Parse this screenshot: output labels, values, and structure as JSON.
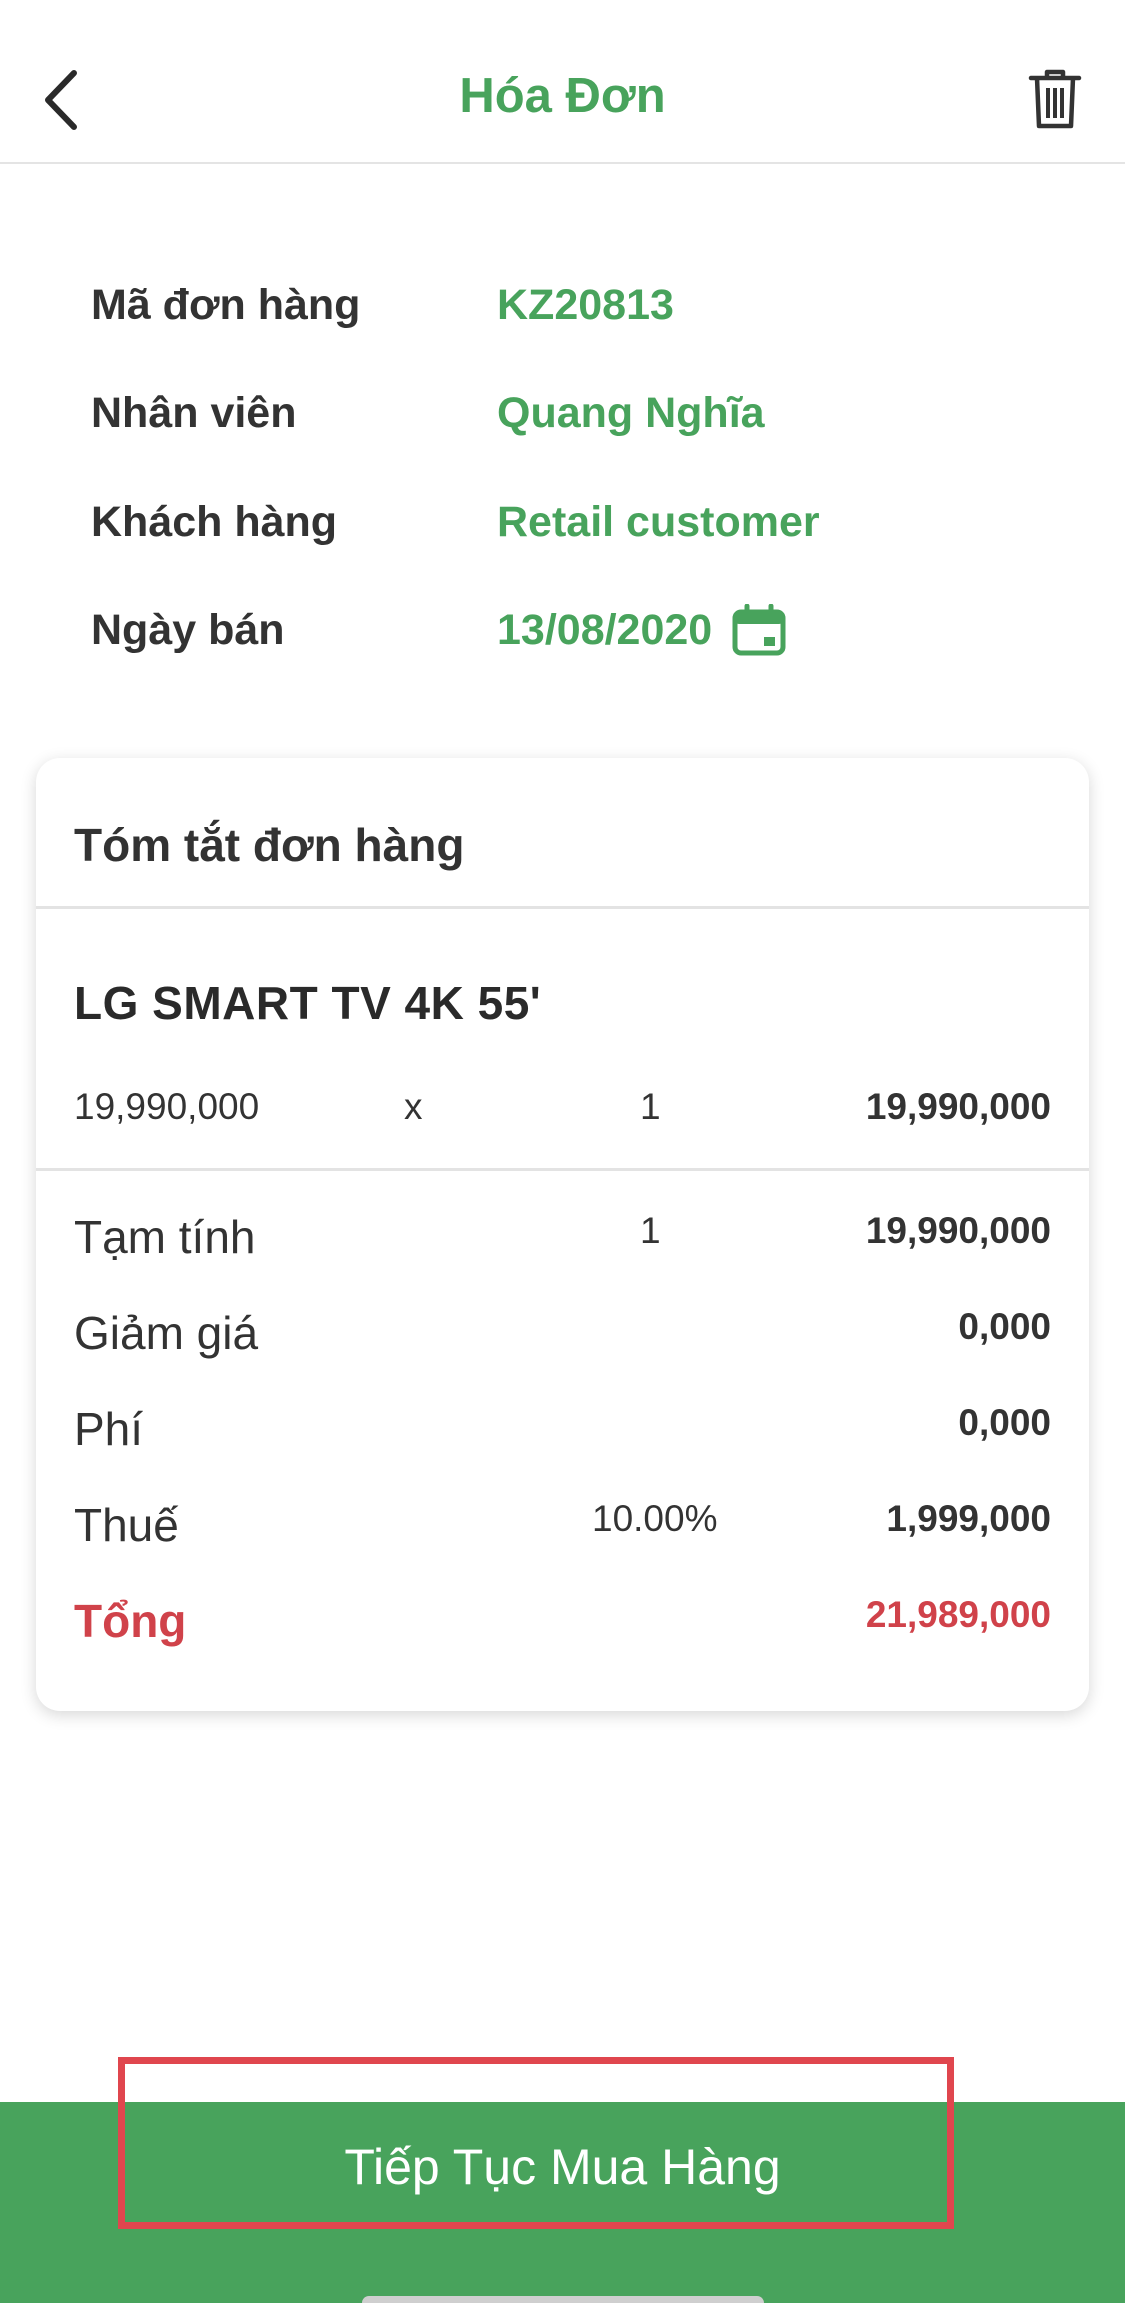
{
  "header": {
    "title": "Hóa Đơn",
    "back_icon": "chevron-left-icon",
    "delete_icon": "trash-icon"
  },
  "order_info": {
    "order_code_label": "Mã đơn hàng",
    "order_code": "KZ20813",
    "staff_label": "Nhân viên",
    "staff": "Quang Nghĩa",
    "customer_label": "Khách hàng",
    "customer": "Retail customer",
    "sale_date_label": "Ngày bán",
    "sale_date": "13/08/2020",
    "date_icon": "calendar-icon"
  },
  "summary": {
    "title": "Tóm tắt đơn hàng",
    "items": [
      {
        "name": "LG SMART TV 4K 55'",
        "unit_price": "19,990,000",
        "times": "x",
        "quantity": "1",
        "line_total": "19,990,000"
      }
    ],
    "subtotal_label": "Tạm tính",
    "subtotal_qty": "1",
    "subtotal_value": "19,990,000",
    "discount_label": "Giảm giá",
    "discount_value": "0,000",
    "fee_label": "Phí",
    "fee_value": "0,000",
    "tax_label": "Thuế",
    "tax_rate": "10.00%",
    "tax_value": "1,999,000",
    "total_label": "Tổng",
    "total_value": "21,989,000"
  },
  "footer": {
    "continue_label": "Tiếp Tục Mua Hàng"
  },
  "colors": {
    "brand_green": "#48a35c",
    "total_red": "#d0424a",
    "highlight_red": "#e0464e"
  }
}
